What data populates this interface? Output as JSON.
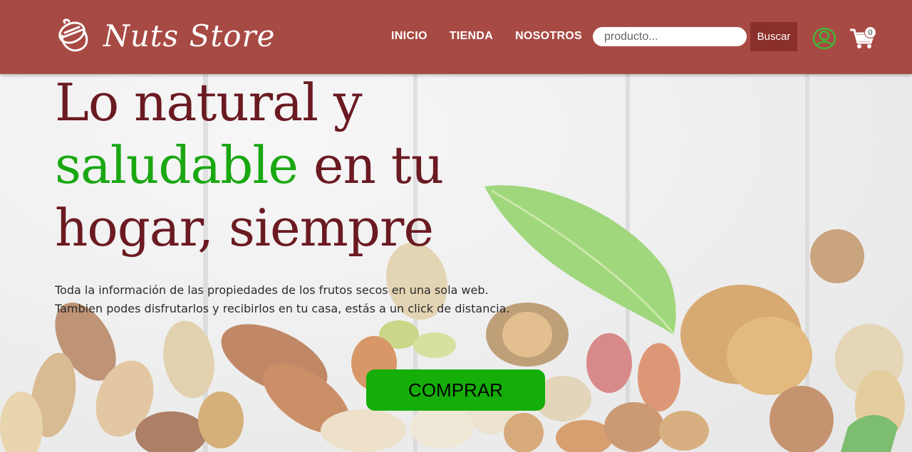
{
  "brand": {
    "name": "Nuts Store",
    "icon": "acorn-icon"
  },
  "nav": {
    "items": [
      {
        "label": "INICIO"
      },
      {
        "label": "TIENDA"
      },
      {
        "label": "NOSOTROS"
      }
    ]
  },
  "search": {
    "placeholder": "producto...",
    "value": "",
    "button_label": "Buscar",
    "icon": "search"
  },
  "account": {
    "icon": "user-circle-icon",
    "color": "#3fb83a"
  },
  "cart": {
    "icon": "shopping-cart-icon",
    "count": "0"
  },
  "hero": {
    "headline_line1": "Lo natural y",
    "headline_highlight": "saludable",
    "headline_line2_rest": " en tu",
    "headline_line3": "hogar, siempre",
    "description_line1": "Toda la información de las propiedades de los frutos secos en una sola web.",
    "description_line2": "Tambien podes disfrutarlos y recibirlos en tu casa, estás a un click de distancia.",
    "cta_label": "COMPRAR"
  },
  "colors": {
    "navbar": "#a84a44",
    "search_button": "#8a2f2b",
    "headline": "#6b1a22",
    "highlight": "#1aa812",
    "cta": "#15ae08"
  }
}
